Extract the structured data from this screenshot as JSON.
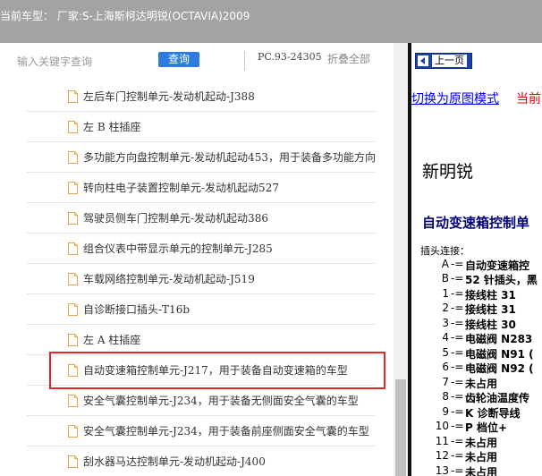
{
  "header": {
    "title": "当前车型： 厂家:S-上海斯柯达明锐(OCTAVIA)2009"
  },
  "toolbar": {
    "search_placeholder": "输入关键字查询",
    "search_button": "查询",
    "code": "PC.93-24305",
    "collapse_all": "折叠全部"
  },
  "tree": {
    "items": [
      {
        "label": "左后车门控制单元-发动机起动-J388"
      },
      {
        "label": "左 B 柱插座"
      },
      {
        "label": "多功能方向盘控制单元-发动机起动453，用于装备多功能方向"
      },
      {
        "label": "转向柱电子装置控制单元-发动机起动527"
      },
      {
        "label": "驾驶员侧车门控制单元-发动机起动386"
      },
      {
        "label": "组合仪表中带显示单元的控制单元-J285"
      },
      {
        "label": "车载网络控制单元-发动机起动-J519"
      },
      {
        "label": "自诊断接口插头-T16b"
      },
      {
        "label": "左 A 柱插座"
      },
      {
        "label": "自动变速箱控制单元-J217，用于装备自动变速箱的车型"
      },
      {
        "label": "安全气囊控制单元-J234，用于装备无侧面安全气囊的车型"
      },
      {
        "label": "安全气囊控制单元-J234，用于装备前座侧面安全气囊的车型"
      },
      {
        "label": "刮水器马达控制单元-发动机起动-J400"
      }
    ],
    "highlight_color": "#e0262b"
  },
  "doc": {
    "prev_button": "上一页",
    "switch_link": "切换为原图模式",
    "current_text": "当前",
    "title": "新明锐",
    "section": "自动变速箱控制单",
    "plug_label": "插头连接：",
    "pins": [
      {
        "id": "A",
        "sep": "-=",
        "desc": "自动变速箱控"
      },
      {
        "id": "B",
        "sep": "-=",
        "desc": "52 针插头，黑"
      },
      {
        "id": "1",
        "sep": "-=",
        "desc": "接线柱 31"
      },
      {
        "id": "2",
        "sep": "-=",
        "desc": "接线柱 31"
      },
      {
        "id": "3",
        "sep": "-=",
        "desc": "接线柱 30"
      },
      {
        "id": "4",
        "sep": "-=",
        "desc": "电磁阀 N283"
      },
      {
        "id": "5",
        "sep": "-=",
        "desc": "电磁阀 N91 ("
      },
      {
        "id": "6",
        "sep": "-=",
        "desc": "电磁阀 N92 ("
      },
      {
        "id": "7",
        "sep": "-=",
        "desc": "未占用"
      },
      {
        "id": "8",
        "sep": "-=",
        "desc": "齿轮油温度传"
      },
      {
        "id": "9",
        "sep": "-=",
        "desc": "K 诊断导线"
      },
      {
        "id": "10",
        "sep": "-=",
        "desc": "P 档位+"
      },
      {
        "id": "11",
        "sep": "-=",
        "desc": "未占用"
      },
      {
        "id": "12",
        "sep": "-=",
        "desc": "未占用"
      },
      {
        "id": "13",
        "sep": "-=",
        "desc": "未占用"
      }
    ]
  },
  "colors": {
    "header_bg": "#a3a3a3",
    "search_button_bg": "#2d7de0",
    "doc_heading": "#00007a",
    "link": "#0000ee",
    "current_red": "#e00000"
  }
}
